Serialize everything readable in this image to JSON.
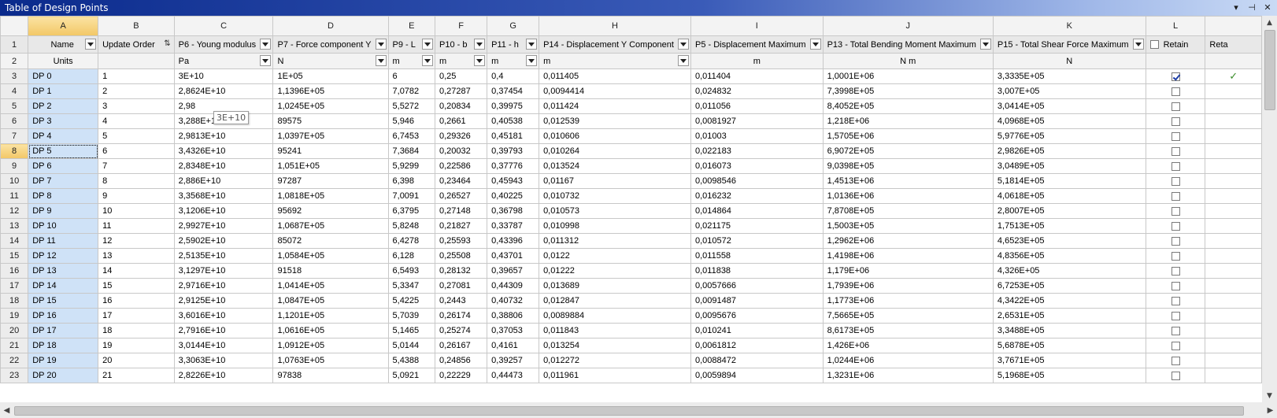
{
  "window": {
    "title": "Table of Design Points"
  },
  "title_buttons": {
    "pin": "▾",
    "dock": "⊣",
    "close": "✕"
  },
  "columns": {
    "letters": [
      "A",
      "B",
      "C",
      "D",
      "E",
      "F",
      "G",
      "H",
      "I",
      "J",
      "K",
      "L",
      ""
    ],
    "names": [
      "Name",
      "Update Order",
      "P6 - Young modulus",
      "P7 - Force component Y",
      "P9 - L",
      "P10 - b",
      "P11 - h",
      "P14 - Displacement Y Component",
      "P5 - Displacement Maximum",
      "P13 - Total Bending Moment Maximum",
      "P15 - Total Shear Force Maximum",
      "Retain",
      "Reta"
    ],
    "units": [
      "Units",
      "",
      "Pa",
      "N",
      "m",
      "m",
      "m",
      "m",
      "m",
      "N m",
      "N",
      "",
      ""
    ]
  },
  "row_numbers": [
    "1",
    "2",
    "3",
    "4",
    "5",
    "6",
    "7",
    "8",
    "9",
    "10",
    "11",
    "12",
    "13",
    "14",
    "15",
    "16",
    "17",
    "18",
    "19",
    "20",
    "21",
    "22",
    "23"
  ],
  "rows": [
    [
      "DP 0",
      "1",
      "3E+10",
      "1E+05",
      "6",
      "0,25",
      "0,4",
      "0,011405",
      "0,011404",
      "1,0001E+06",
      "3,3335E+05"
    ],
    [
      "DP 1",
      "2",
      "2,8624E+10",
      "1,1396E+05",
      "7,0782",
      "0,27287",
      "0,37454",
      "0,0094414",
      "0,024832",
      "7,3998E+05",
      "3,007E+05"
    ],
    [
      "DP 2",
      "3",
      "2,98",
      "1,0245E+05",
      "5,5272",
      "0,20834",
      "0,39975",
      "0,011424",
      "0,011056",
      "8,4052E+05",
      "3,0414E+05"
    ],
    [
      "DP 3",
      "4",
      "3,288E+10",
      "89575",
      "5,946",
      "0,2661",
      "0,40538",
      "0,012539",
      "0,0081927",
      "1,218E+06",
      "4,0968E+05"
    ],
    [
      "DP 4",
      "5",
      "2,9813E+10",
      "1,0397E+05",
      "6,7453",
      "0,29326",
      "0,45181",
      "0,010606",
      "0,01003",
      "1,5705E+06",
      "5,9776E+05"
    ],
    [
      "DP 5",
      "6",
      "3,4326E+10",
      "95241",
      "7,3684",
      "0,20032",
      "0,39793",
      "0,010264",
      "0,022183",
      "6,9072E+05",
      "2,9826E+05"
    ],
    [
      "DP 6",
      "7",
      "2,8348E+10",
      "1,051E+05",
      "5,9299",
      "0,22586",
      "0,37776",
      "0,013524",
      "0,016073",
      "9,0398E+05",
      "3,0489E+05"
    ],
    [
      "DP 7",
      "8",
      "2,886E+10",
      "97287",
      "6,398",
      "0,23464",
      "0,45943",
      "0,01167",
      "0,0098546",
      "1,4513E+06",
      "5,1814E+05"
    ],
    [
      "DP 8",
      "9",
      "3,3568E+10",
      "1,0818E+05",
      "7,0091",
      "0,26527",
      "0,40225",
      "0,010732",
      "0,016232",
      "1,0136E+06",
      "4,0618E+05"
    ],
    [
      "DP 9",
      "10",
      "3,1206E+10",
      "95692",
      "6,3795",
      "0,27148",
      "0,36798",
      "0,010573",
      "0,014864",
      "7,8708E+05",
      "2,8007E+05"
    ],
    [
      "DP 10",
      "11",
      "2,9927E+10",
      "1,0687E+05",
      "5,8248",
      "0,21827",
      "0,33787",
      "0,010998",
      "0,021175",
      "1,5003E+05",
      "1,7513E+05"
    ],
    [
      "DP 11",
      "12",
      "2,5902E+10",
      "85072",
      "6,4278",
      "0,25593",
      "0,43396",
      "0,011312",
      "0,010572",
      "1,2962E+06",
      "4,6523E+05"
    ],
    [
      "DP 12",
      "13",
      "2,5135E+10",
      "1,0584E+05",
      "6,128",
      "0,25508",
      "0,43701",
      "0,0122",
      "0,011558",
      "1,4198E+06",
      "4,8356E+05"
    ],
    [
      "DP 13",
      "14",
      "3,1297E+10",
      "91518",
      "6,5493",
      "0,28132",
      "0,39657",
      "0,01222",
      "0,011838",
      "1,179E+06",
      "4,326E+05"
    ],
    [
      "DP 14",
      "15",
      "2,9716E+10",
      "1,0414E+05",
      "5,3347",
      "0,27081",
      "0,44309",
      "0,013689",
      "0,0057666",
      "1,7939E+06",
      "6,7253E+05"
    ],
    [
      "DP 15",
      "16",
      "2,9125E+10",
      "1,0847E+05",
      "5,4225",
      "0,2443",
      "0,40732",
      "0,012847",
      "0,0091487",
      "1,1773E+06",
      "4,3422E+05"
    ],
    [
      "DP 16",
      "17",
      "3,6016E+10",
      "1,1201E+05",
      "5,7039",
      "0,26174",
      "0,38806",
      "0,0089884",
      "0,0095676",
      "7,5665E+05",
      "2,6531E+05"
    ],
    [
      "DP 17",
      "18",
      "2,7916E+10",
      "1,0616E+05",
      "5,1465",
      "0,25274",
      "0,37053",
      "0,011843",
      "0,010241",
      "8,6173E+05",
      "3,3488E+05"
    ],
    [
      "DP 18",
      "19",
      "3,0144E+10",
      "1,0912E+05",
      "5,0144",
      "0,26167",
      "0,4161",
      "0,013254",
      "0,0061812",
      "1,426E+06",
      "5,6878E+05"
    ],
    [
      "DP 19",
      "20",
      "3,3063E+10",
      "1,0763E+05",
      "5,4388",
      "0,24856",
      "0,39257",
      "0,012272",
      "0,0088472",
      "1,0244E+06",
      "3,7671E+05"
    ],
    [
      "DP 20",
      "21",
      "2,8226E+10",
      "97838",
      "5,0921",
      "0,22229",
      "0,44473",
      "0,011961",
      "0,0059894",
      "1,3231E+06",
      "5,1968E+05"
    ]
  ],
  "retain_checked": [
    true,
    false,
    false,
    false,
    false,
    false,
    false,
    false,
    false,
    false,
    false,
    false,
    false,
    false,
    false,
    false,
    false,
    false,
    false,
    false,
    false
  ],
  "status_marks": [
    "✓",
    "",
    "",
    "",
    "",
    "",
    "",
    "",
    "",
    "",
    "",
    "",
    "",
    "",
    "",
    "",
    "",
    "",
    "",
    "",
    ""
  ],
  "tooltip": "3E+10",
  "scroll_arrows": {
    "up": "▲",
    "down": "▼",
    "left": "◀",
    "right": "▶"
  },
  "colors": {
    "selected_header": "#f2c766",
    "name_column": "#cfe2f7",
    "title_start": "#0a2a8c",
    "check_mark": "#3a8c2a"
  }
}
